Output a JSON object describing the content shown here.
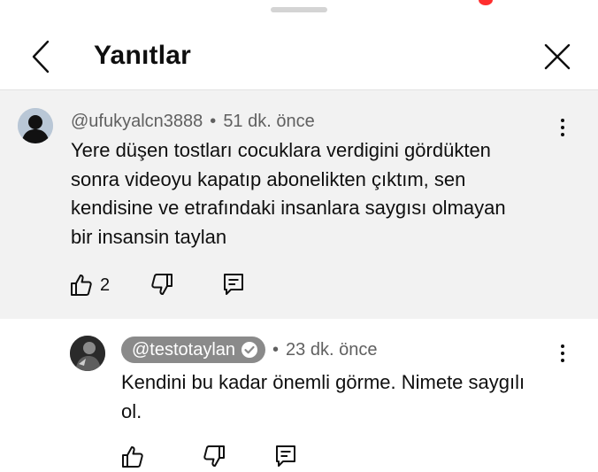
{
  "header": {
    "title": "Yanıtlar"
  },
  "parent_comment": {
    "author": "@ufukyalcn3888",
    "separator": "•",
    "time": "51 dk. önce",
    "text_lines": [
      "Yere düşen tostları cocuklara verdigini gördükten",
      "sonra videoyu kapatıp abonelikten çıktım, sen",
      "kendisine ve etrafındaki insanlara saygısı olmayan",
      "bir insansin taylan"
    ],
    "like_count": "2"
  },
  "reply_comment": {
    "author": "@testotaylan",
    "separator": "•",
    "time": "23 dk. önce",
    "text_lines": [
      "Kendini bu kadar önemli görme. Nimete saygılı",
      "ol."
    ]
  },
  "icons": {
    "back": "chevron-left-icon",
    "close": "close-icon",
    "like": "thumbs-up-icon",
    "dislike": "thumbs-down-icon",
    "reply": "reply-icon",
    "more": "more-vertical-icon",
    "verified": "verified-check-icon"
  },
  "colors": {
    "parent_background": "#f2f2f2",
    "meta_text": "#606060",
    "author_chip": "#8a8a8a",
    "notification_dot": "#ff2e2e"
  }
}
